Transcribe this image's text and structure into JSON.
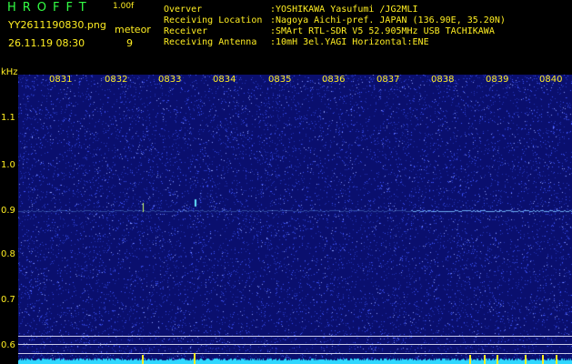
{
  "header": {
    "app_title": "HROFFT",
    "version": "1.00f",
    "filename": "YY2611190830.png",
    "datetime": "26.11.19 08:30",
    "meteor_label": "meteor",
    "meteor_count": "9"
  },
  "info": [
    {
      "label": "Overver",
      "value": ":YOSHIKAWA Yasufumi /JG2MLI"
    },
    {
      "label": "Receiving Location",
      "value": ":Nagoya Aichi-pref. JAPAN (136.90E, 35.20N)"
    },
    {
      "label": "Receiver",
      "value": ":SMArt RTL-SDR V5 52.905MHz USB TACHIKAWA"
    },
    {
      "label": "Receiving Antenna",
      "value": ":10mH 3el.YAGI Horizontal:ENE"
    }
  ],
  "spectrogram": {
    "y_unit": "kHz",
    "time_labels": [
      "0831",
      "0832",
      "0833",
      "0834",
      "0835",
      "0836",
      "0837",
      "0838",
      "0839",
      "0840"
    ],
    "freq_labels": [
      "1.1",
      "1.0",
      "0.9",
      "0.8",
      "0.7",
      "0.6"
    ],
    "colors": {
      "background": "#0a0f6e",
      "noise": "#3f55ff",
      "baseline": "#30d8ff",
      "labels": "#ffee22",
      "header_green": "#33ff44"
    }
  }
}
